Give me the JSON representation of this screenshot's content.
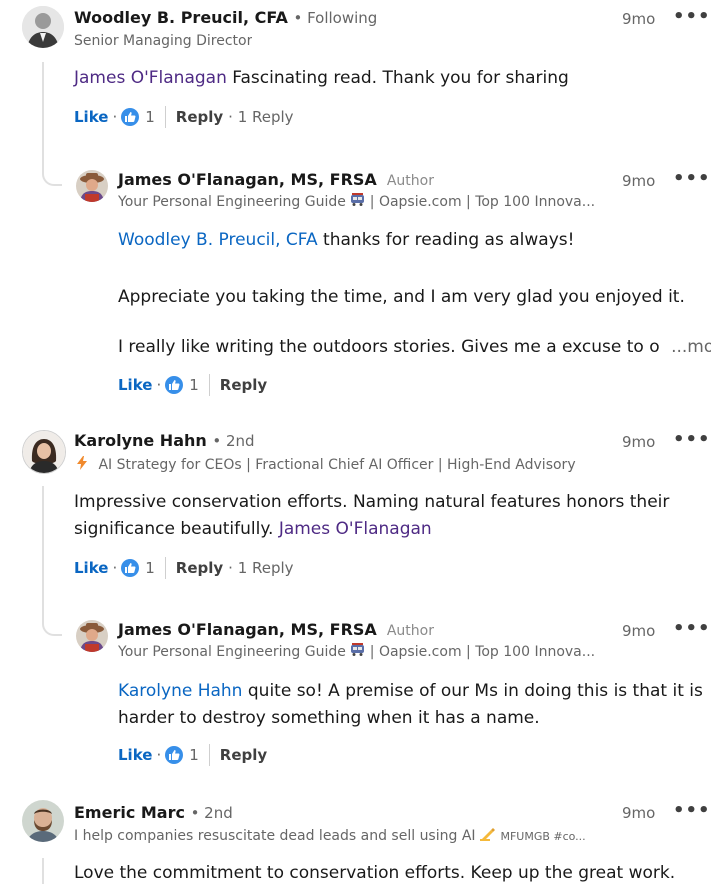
{
  "comments": [
    {
      "name": "Woodley B. Preucil, CFA",
      "degree": "• Following",
      "headline": "Senior Managing Director",
      "time": "9mo",
      "mention": "James O'Flanagan",
      "text": " Fascinating read. Thank you for sharing",
      "like": "Like",
      "dot": "·",
      "count": "1",
      "reply": "Reply",
      "replies": "· 1 Reply",
      "reply_comment": {
        "name": "James O'Flanagan, MS, FRSA",
        "badge": "Author",
        "headline_a": "Your Personal Engineering Guide",
        "headline_b": "| Oapsie.com | Top 100 Innova...",
        "time": "9mo",
        "mention": "Woodley B. Preucil, CFA",
        "line1": " thanks for reading as always!",
        "line2": "Appreciate you taking the time, and I am very glad you enjoyed it.",
        "line3": "I really like writing the outdoors stories. Gives me a excuse to o",
        "more": "...more",
        "like": "Like",
        "dot": "·",
        "count": "1",
        "reply": "Reply"
      }
    },
    {
      "name": "Karolyne Hahn",
      "degree": "• 2nd",
      "headline": "AI Strategy for CEOs | Fractional Chief AI Officer | High-End Advisory",
      "time": "9mo",
      "text_a": "Impressive conservation efforts. Naming natural features honors their",
      "text_b": "significance beautifully. ",
      "mention": "James O'Flanagan",
      "like": "Like",
      "dot": "·",
      "count": "1",
      "reply": "Reply",
      "replies": "· 1 Reply",
      "reply_comment": {
        "name": "James O'Flanagan, MS, FRSA",
        "badge": "Author",
        "headline_a": "Your Personal Engineering Guide",
        "headline_b": "| Oapsie.com | Top 100 Innova...",
        "time": "9mo",
        "mention": "Karolyne Hahn",
        "line1": " quite so! A premise of our Ms in doing this is that it is",
        "line2": "harder to destroy something when it has a name.",
        "like": "Like",
        "dot": "·",
        "count": "1",
        "reply": "Reply"
      }
    },
    {
      "name": "Emeric Marc",
      "degree": "• 2nd",
      "headline_a": "I help companies resuscitate dead leads and sell using AI",
      "headline_b": "MFUMGB #co...",
      "time": "9mo",
      "text": "Love the commitment to conservation efforts. Keep up the great work."
    }
  ],
  "more_menu_icon": "ellipsis-icon",
  "colors": {
    "link_blue": "#0a66c2",
    "mention_purple": "#4e2a84",
    "reaction_blue": "#378fe9"
  }
}
